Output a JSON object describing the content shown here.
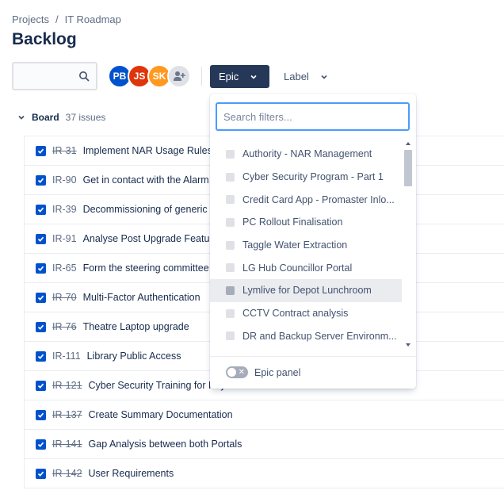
{
  "breadcrumb": {
    "root": "Projects",
    "separator": "/",
    "project": "IT Roadmap"
  },
  "page_title": "Backlog",
  "search": {
    "placeholder": ""
  },
  "avatars": [
    {
      "initials": "PB",
      "color": "#0052cc"
    },
    {
      "initials": "JS",
      "color": "#de350b"
    },
    {
      "initials": "SK",
      "color": "#ff991f"
    }
  ],
  "filters": {
    "epic_label": "Epic",
    "label_label": "Label"
  },
  "board": {
    "title": "Board",
    "count": "37 issues"
  },
  "issues": [
    {
      "key": "IR-31",
      "done": true,
      "summary": "Implement NAR Usage Rules"
    },
    {
      "key": "IR-90",
      "done": false,
      "summary": "Get in contact with the Alarm"
    },
    {
      "key": "IR-39",
      "done": false,
      "summary": "Decommissioning of generic"
    },
    {
      "key": "IR-91",
      "done": false,
      "summary": "Analyse Post Upgrade Feature"
    },
    {
      "key": "IR-65",
      "done": false,
      "summary": "Form the steering committee"
    },
    {
      "key": "IR-70",
      "done": true,
      "summary": "Multi-Factor Authentication"
    },
    {
      "key": "IR-76",
      "done": true,
      "summary": "Theatre Laptop upgrade"
    },
    {
      "key": "IR-111",
      "done": false,
      "summary": "Library Public Access"
    },
    {
      "key": "IR-121",
      "done": true,
      "summary": "Cyber Security Training for Key Staff"
    },
    {
      "key": "IR-137",
      "done": true,
      "summary": "Create Summary Documentation"
    },
    {
      "key": "IR-141",
      "done": true,
      "summary": "Gap Analysis between both Portals"
    },
    {
      "key": "IR-142",
      "done": true,
      "summary": "User Requirements"
    }
  ],
  "epic_dropdown": {
    "search_placeholder": "Search filters...",
    "options": [
      "Authority - NAR Management",
      "Cyber Security Program - Part 1",
      "Credit Card App - Promaster Inlo...",
      "PC Rollout Finalisation",
      "Taggle Water Extraction",
      "LG Hub Councillor Portal",
      "Lymlive for Depot Lunchroom",
      "CCTV Contract analysis",
      "DR and Backup Server Environm..."
    ],
    "hovered_index": 6,
    "epic_panel_label": "Epic panel"
  },
  "colors": {
    "accent": "#0052cc",
    "epic_button_bg": "#253858",
    "focus_border": "#4c9aff"
  }
}
